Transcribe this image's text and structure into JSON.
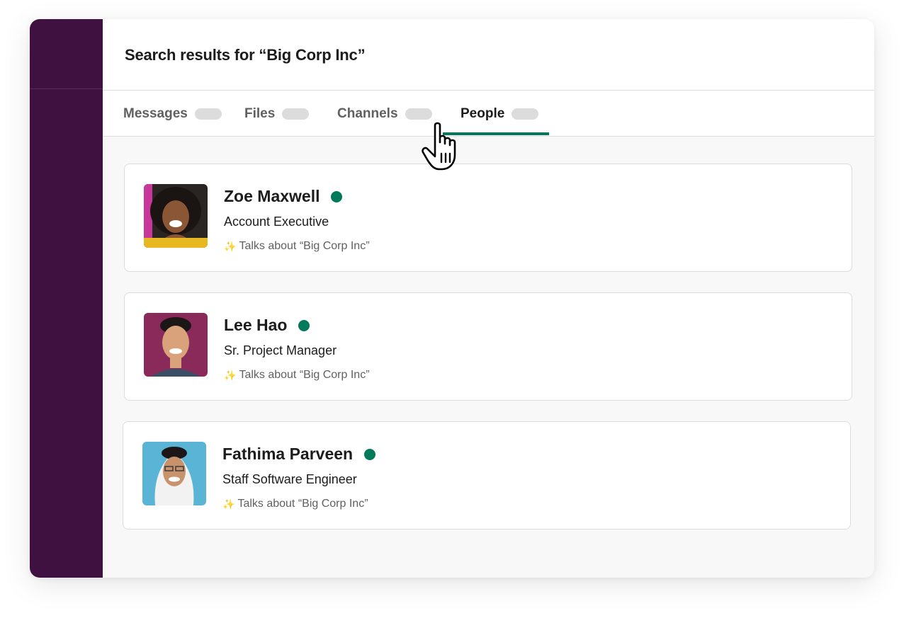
{
  "header": {
    "title": "Search results for “Big Corp Inc”"
  },
  "tabs": [
    {
      "label": "Messages",
      "active": false
    },
    {
      "label": "Files",
      "active": false
    },
    {
      "label": "Channels",
      "active": false
    },
    {
      "label": "People",
      "active": true
    }
  ],
  "people": [
    {
      "name": "Zoe Maxwell",
      "title": "Account Executive",
      "talks": "Talks about “Big Corp Inc”",
      "status": "online",
      "avatar_icon": "avatar-icon"
    },
    {
      "name": "Lee Hao",
      "title": "Sr. Project Manager",
      "talks": "Talks about “Big Corp Inc”",
      "status": "online",
      "avatar_icon": "avatar-icon"
    },
    {
      "name": "Fathima Parveen",
      "title": "Staff Software Engineer",
      "talks": "Talks about “Big Corp Inc”",
      "status": "online",
      "avatar_icon": "avatar-icon"
    }
  ],
  "colors": {
    "sidebar": "#3f1140",
    "accent": "#007a5a",
    "presence": "#007a5a"
  }
}
